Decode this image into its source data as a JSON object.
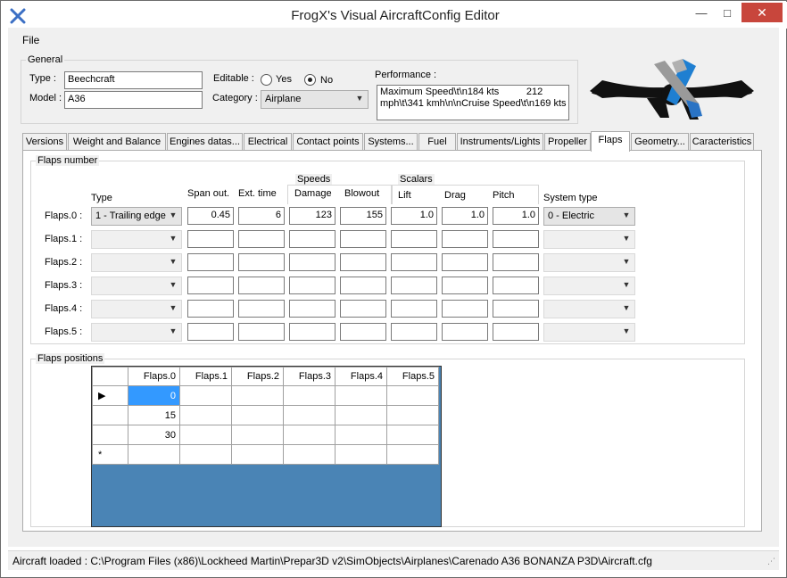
{
  "window": {
    "title": "FrogX's Visual AircraftConfig Editor",
    "minimize_glyph": "—",
    "maximize_glyph": "□",
    "close_glyph": "✕",
    "accent_close": "#c8463c"
  },
  "menu": {
    "file_label": "File"
  },
  "general": {
    "legend": "General",
    "type_label": "Type :",
    "type_value": "Beechcraft",
    "model_label": "Model :",
    "model_value": "A36",
    "editable_label": "Editable :",
    "editable_yes": "Yes",
    "editable_no": "No",
    "editable_selected": "No",
    "category_label": "Category :",
    "category_value": "Airplane",
    "performance_label": "Performance :",
    "performance_value": "Maximum Speed\\t\\n184 kts          212\nmph\\t\\341 kmh\\n\\nCruise Speed\\t\\n169 kts"
  },
  "tabs": [
    "Versions",
    "Weight and Balance",
    "Engines datas...",
    "Electrical",
    "Contact points",
    "Systems...",
    "Fuel",
    "Instruments/Lights",
    "Propeller",
    "Flaps",
    "Geometry...",
    "Caracteristics"
  ],
  "active_tab": "Flaps",
  "flaps_number": {
    "legend": "Flaps number",
    "headers": {
      "type": "Type",
      "span_out": "Span out.",
      "ext_time": "Ext. time",
      "speeds_group": "Speeds",
      "damage": "Damage",
      "blowout": "Blowout",
      "scalars_group": "Scalars",
      "lift": "Lift",
      "drag": "Drag",
      "pitch": "Pitch",
      "system_type": "System type"
    },
    "rows": [
      {
        "label": "Flaps.0 :",
        "type": "1 - Trailing edge",
        "span_out": "0.45",
        "ext_time": "6",
        "damage": "123",
        "blowout": "155",
        "lift": "1.0",
        "drag": "1.0",
        "pitch": "1.0",
        "system_type": "0 - Electric",
        "enabled": true
      },
      {
        "label": "Flaps.1 :",
        "type": "",
        "span_out": "",
        "ext_time": "",
        "damage": "",
        "blowout": "",
        "lift": "",
        "drag": "",
        "pitch": "",
        "system_type": "",
        "enabled": false
      },
      {
        "label": "Flaps.2 :",
        "type": "",
        "span_out": "",
        "ext_time": "",
        "damage": "",
        "blowout": "",
        "lift": "",
        "drag": "",
        "pitch": "",
        "system_type": "",
        "enabled": false
      },
      {
        "label": "Flaps.3 :",
        "type": "",
        "span_out": "",
        "ext_time": "",
        "damage": "",
        "blowout": "",
        "lift": "",
        "drag": "",
        "pitch": "",
        "system_type": "",
        "enabled": false
      },
      {
        "label": "Flaps.4 :",
        "type": "",
        "span_out": "",
        "ext_time": "",
        "damage": "",
        "blowout": "",
        "lift": "",
        "drag": "",
        "pitch": "",
        "system_type": "",
        "enabled": false
      },
      {
        "label": "Flaps.5 :",
        "type": "",
        "span_out": "",
        "ext_time": "",
        "damage": "",
        "blowout": "",
        "lift": "",
        "drag": "",
        "pitch": "",
        "system_type": "",
        "enabled": false
      }
    ]
  },
  "flaps_positions": {
    "legend": "Flaps positions",
    "columns": [
      "Flaps.0",
      "Flaps.1",
      "Flaps.2",
      "Flaps.3",
      "Flaps.4",
      "Flaps.5"
    ],
    "rows": [
      {
        "indicator": "▶",
        "cells": [
          "0",
          "",
          "",
          "",
          "",
          ""
        ]
      },
      {
        "indicator": "",
        "cells": [
          "15",
          "",
          "",
          "",
          "",
          ""
        ]
      },
      {
        "indicator": "",
        "cells": [
          "30",
          "",
          "",
          "",
          "",
          ""
        ]
      },
      {
        "indicator": "*",
        "cells": [
          "",
          "",
          "",
          "",
          "",
          ""
        ]
      }
    ],
    "grid_background": "#4a84b5"
  },
  "status": {
    "text": "Aircraft loaded : C:\\Program Files (x86)\\Lockheed Martin\\Prepar3D v2\\SimObjects\\Airplanes\\Carenado A36 BONANZA P3D\\Aircraft.cfg"
  }
}
